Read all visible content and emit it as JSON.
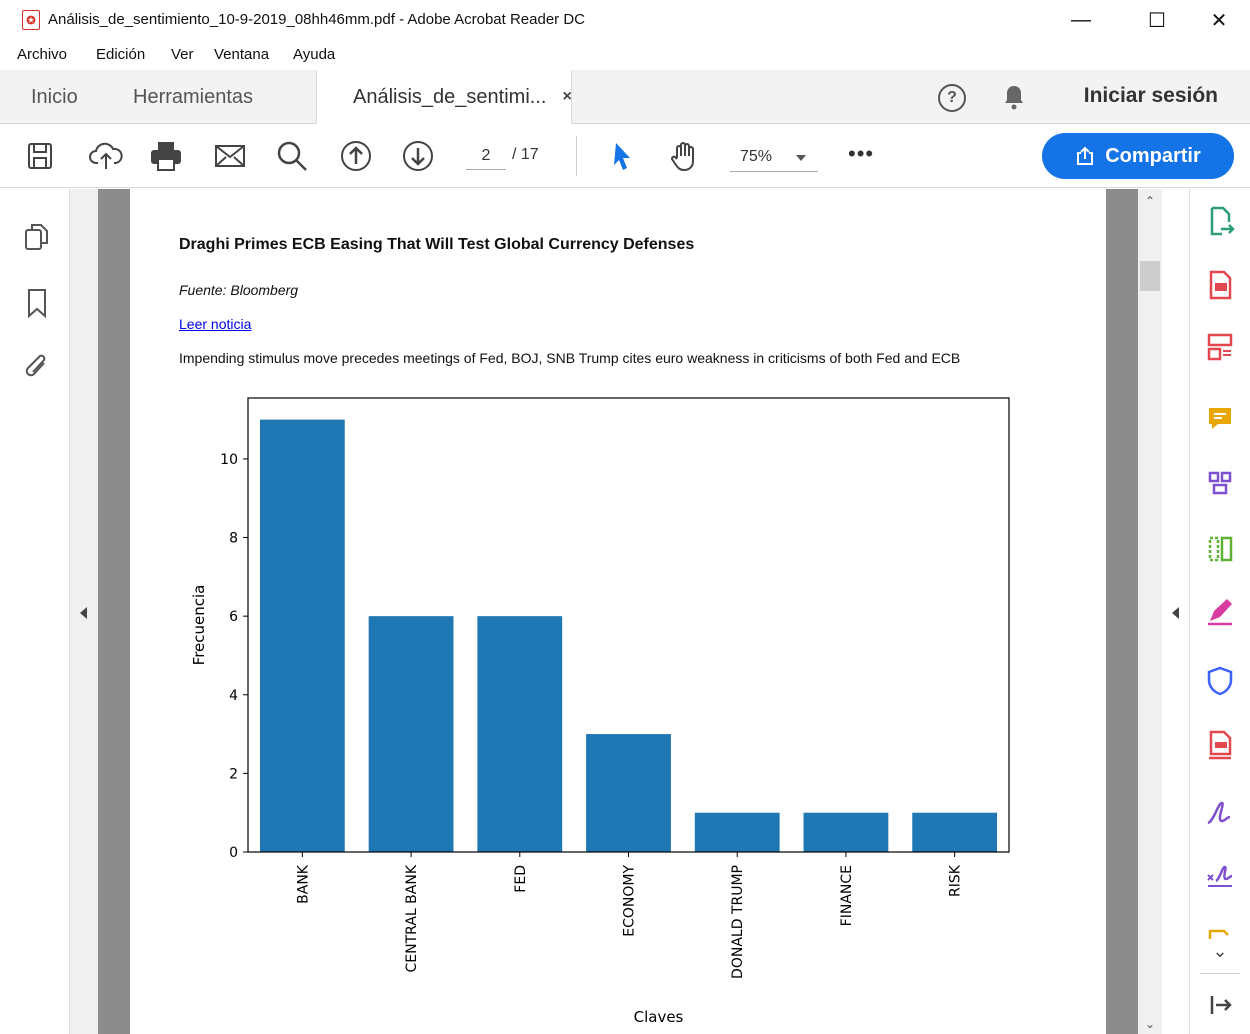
{
  "window": {
    "title": "Análisis_de_sentimiento_10-9-2019_08hh46mm.pdf - Adobe Acrobat Reader DC",
    "minimize": "—",
    "maximize": "☐",
    "close": "✕"
  },
  "menu": {
    "items": [
      "Archivo",
      "Edición",
      "Ver",
      "Ventana",
      "Ayuda"
    ]
  },
  "tabs": {
    "home": "Inicio",
    "tools": "Herramientas",
    "doc": "Análisis_de_sentimi...",
    "doc_close": "×"
  },
  "header": {
    "signin": "Iniciar sesión",
    "help": "?"
  },
  "toolbar": {
    "page_current": "2",
    "page_total": "/ 17",
    "zoom": "75%",
    "more": "•••",
    "share": "Compartir"
  },
  "document": {
    "title": "Draghi Primes ECB Easing That Will Test Global Currency Defenses",
    "source": "Fuente: Bloomberg",
    "link": "Leer noticia",
    "summary": "Impending stimulus move precedes meetings of Fed, BOJ, SNB Trump cites euro weakness in criticisms of both Fed and ECB"
  },
  "chart_data": {
    "type": "bar",
    "categories": [
      "BANK",
      "CENTRAL BANK",
      "FED",
      "ECONOMY",
      "DONALD TRUMP",
      "FINANCE",
      "RISK"
    ],
    "values": [
      11,
      6,
      6,
      3,
      1,
      1,
      1
    ],
    "xlabel": "Claves",
    "ylabel": "Frecuencia",
    "ylim": [
      0,
      11.55
    ],
    "yticks": [
      0,
      2,
      4,
      6,
      8,
      10
    ],
    "color": "#1f77b4"
  },
  "colors": {
    "accent": "#1473e6",
    "bar": "#1f77b4"
  }
}
